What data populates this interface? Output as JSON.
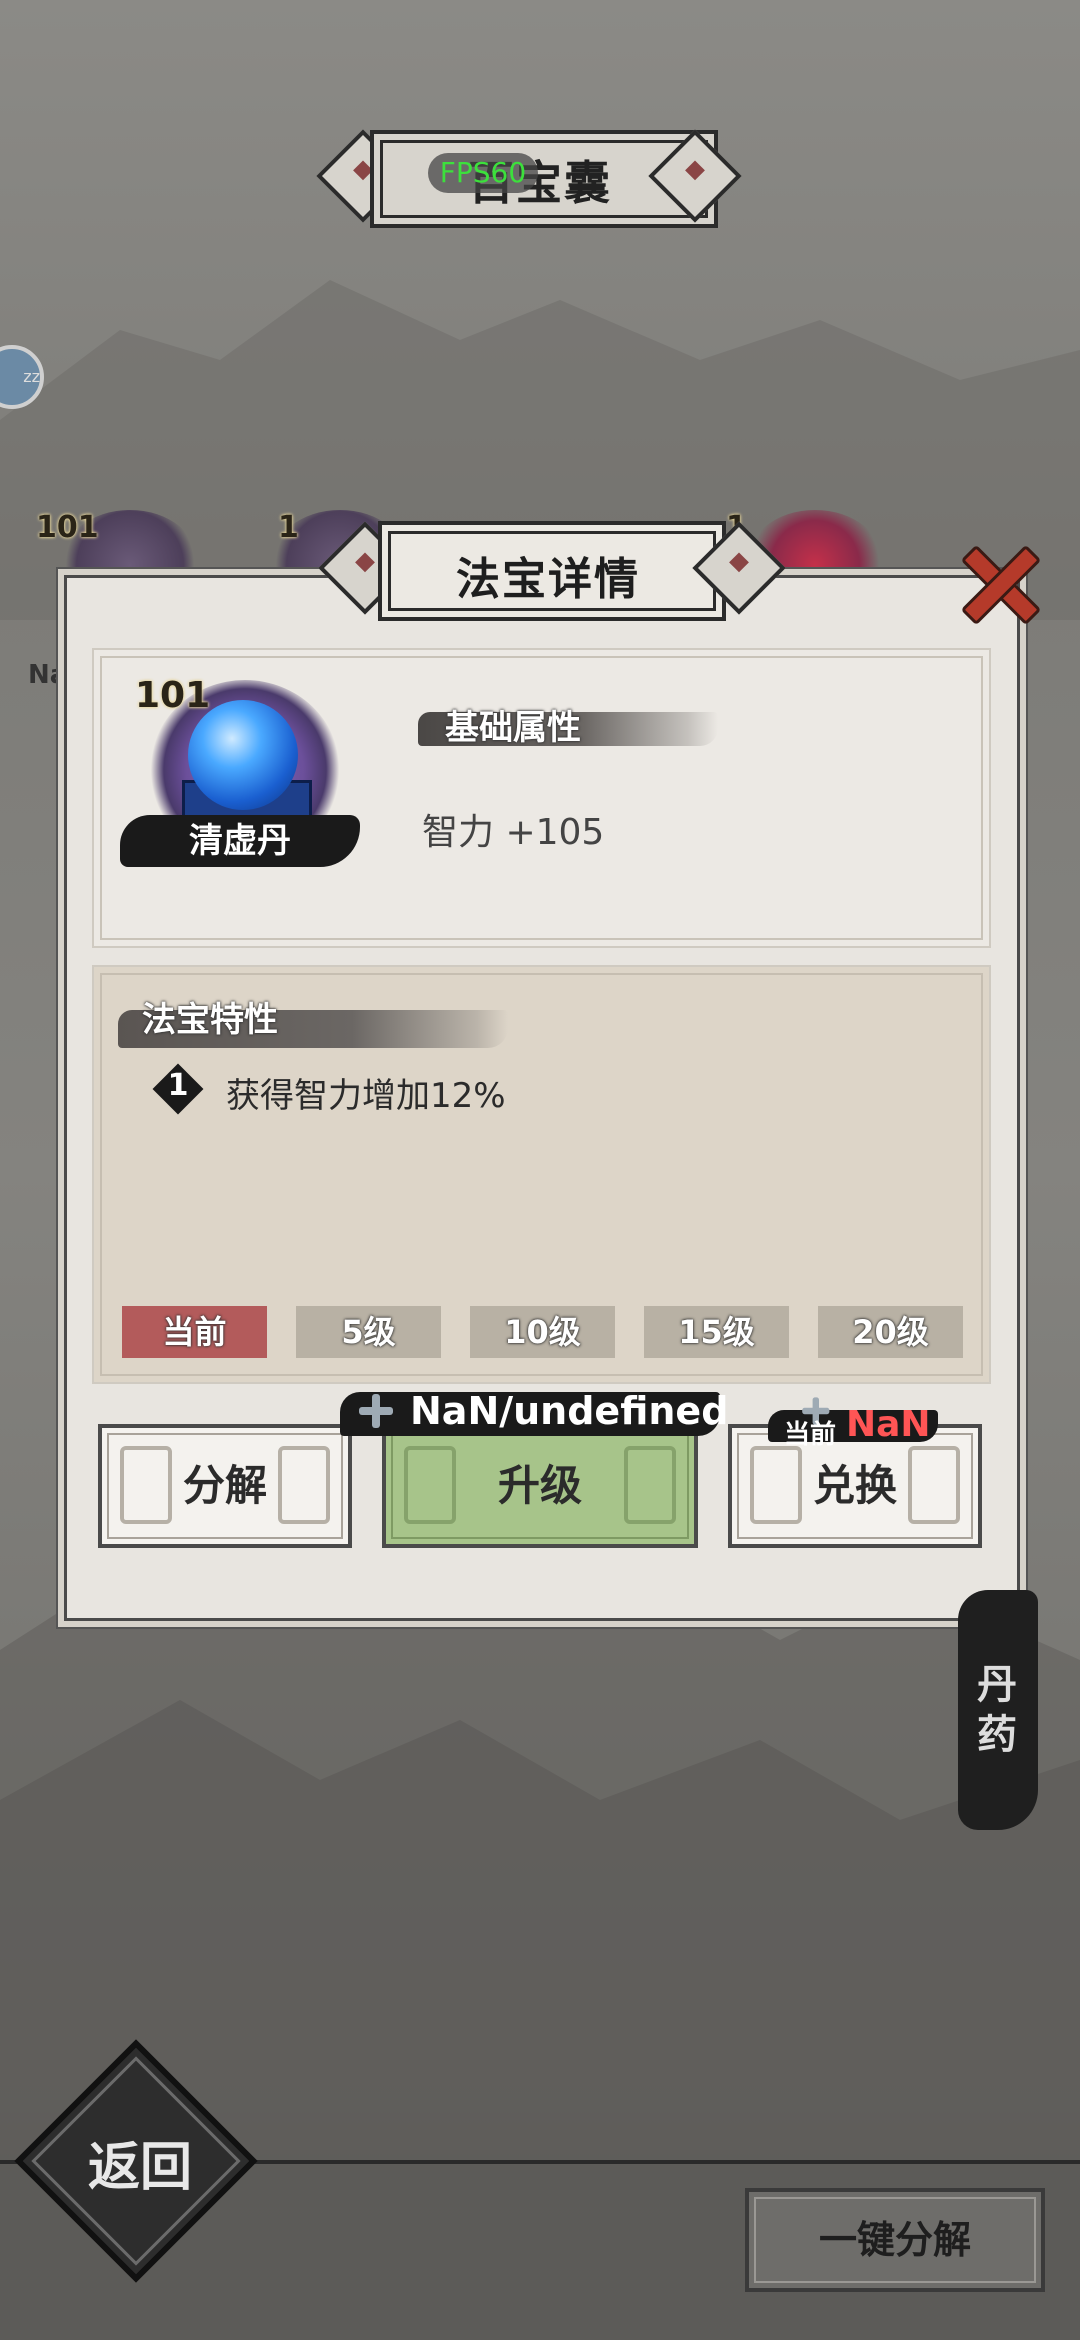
{
  "screen": {
    "title": "百宝囊",
    "fps_label": "FPS60",
    "side_tag": "丹药",
    "background_item_levels": [
      "101",
      "1",
      "1"
    ],
    "side_partial_label": "Na"
  },
  "modal": {
    "title": "法宝详情",
    "item": {
      "level": "101",
      "name": "清虚丹"
    },
    "basic_attr_label": "基础属性",
    "stat": "智力 +105",
    "trait_label": "法宝特性",
    "traits": [
      {
        "num": "1",
        "text": "获得智力增加12%"
      }
    ],
    "level_tabs": [
      "当前",
      "5级",
      "10级",
      "15级",
      "20级"
    ],
    "buttons": {
      "decompose": "分解",
      "upgrade": "升级",
      "exchange": "兑换"
    },
    "upgrade_cost": "NaN/undefined",
    "exchange_current_label": "当前",
    "exchange_current_value": "NaN"
  },
  "bottom": {
    "back": "返回",
    "one_key_decompose": "一键分解"
  },
  "colors": {
    "accent_red": "#b35b5b",
    "upgrade_green": "#a7c48a",
    "fps_green": "#3ce03c",
    "warning_red": "#ff5555"
  }
}
